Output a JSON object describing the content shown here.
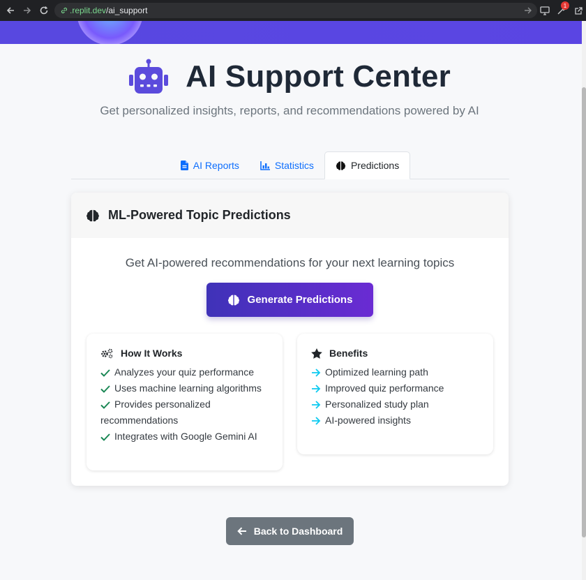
{
  "browser": {
    "url_host": ".replit.dev",
    "url_path": "/ai_support",
    "notification_count": "1"
  },
  "page": {
    "title": "AI Support Center",
    "subtitle": "Get personalized insights, reports, and recommendations powered by AI"
  },
  "tabs": [
    {
      "label": "AI Reports",
      "icon": "file-icon",
      "active": false
    },
    {
      "label": "Statistics",
      "icon": "bar-chart-icon",
      "active": false
    },
    {
      "label": "Predictions",
      "icon": "brain-icon",
      "active": true
    }
  ],
  "card": {
    "header": "ML-Powered Topic Predictions",
    "lead": "Get AI-powered recommendations for your next learning topics",
    "generate_label": "Generate Predictions",
    "how": {
      "title": "How It Works",
      "items": [
        "Analyzes your quiz performance",
        "Uses machine learning algorithms",
        "Provides personalized recommendations",
        "Integrates with Google Gemini AI"
      ]
    },
    "benefits": {
      "title": "Benefits",
      "items": [
        "Optimized learning path",
        "Improved quiz performance",
        "Personalized study plan",
        "AI-powered insights"
      ]
    }
  },
  "back_label": "Back to Dashboard",
  "colors": {
    "accent": "#0d6efd",
    "primary_start": "#3f32b8",
    "primary_end": "#6a2bd3",
    "check": "#198754",
    "arrow": "#0dcaf0",
    "secondary": "#6c757d"
  }
}
